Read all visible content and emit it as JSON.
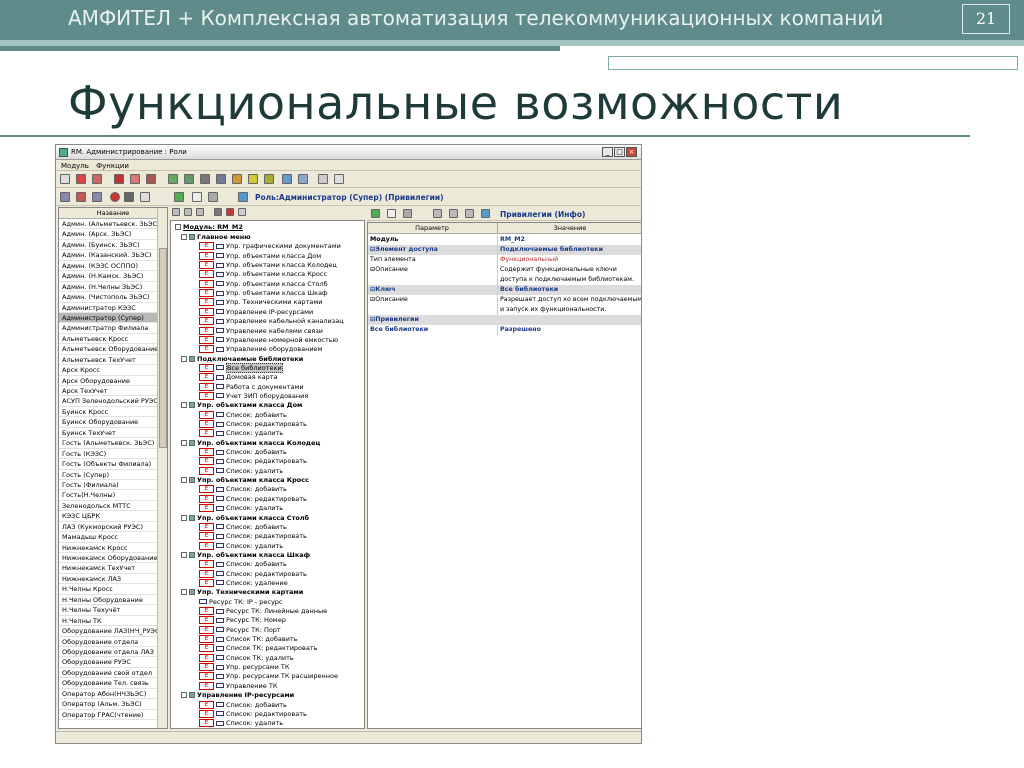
{
  "slide": {
    "header": "АМФИТЕЛ + Комплексная автоматизация телекоммуникационных компаний",
    "number": "21",
    "title": "Функциональные возможности"
  },
  "window": {
    "title": "RM. Администрирование : Роли",
    "menu": [
      "Модуль",
      "Функции"
    ],
    "role_title": "Роль:Администратор (Супер) (Привилегии)",
    "info_title": "Привилегии (Инфо)"
  },
  "roles": {
    "header": "Название",
    "items": [
      "Админ. (Альметьевск. ЗЬЭС)",
      "Админ. (Арск. ЗЬЭС)",
      "Админ. (Буинск. ЗЬЭС)",
      "Админ. (Казанский. ЗЬЭС)",
      "Админ. (КЭЗС ОСППО)",
      "Админ. (Н.Камск. ЗЬЭС)",
      "Админ. (Н.Челны ЗЬЭС)",
      "Админ. (Чистополь ЗЬЭС)",
      "Администратор КЭЗС",
      "Администратор (Супер)",
      "Администратор Филиала",
      "Альметьевск Кросс",
      "Альметьевск Оборудование",
      "Альметьевск ТехУчет",
      "Арск Кросс",
      "Арск Оборудование",
      "Арск ТехУчет",
      "АСУП Зеленодольский РУЭС",
      "Буинск Кросс",
      "Буинск Оборудование",
      "Буинск ТехУчет",
      "Гость (Альметьевск. ЗЬЭС)",
      "Гость (КЭЗС)",
      "Гость (Объекты Филиала)",
      "Гость (Супер)",
      "Гость (Филиала)",
      "Гость(Н.Челны)",
      "Зеленодольск МТТС",
      "КЭЗС ЦБРК",
      "ЛАЗ (Кукморский РУЭС)",
      "Мамадыш Кросс",
      "Нижнекамск Кросс",
      "Нижнекамск Оборудование",
      "Нижнекамск ТехУчет",
      "Нижнекамск ЛАЗ",
      "Н.Челны Кросс",
      "Н.Челны Оборудование",
      "Н.Челны Техучёт",
      "Н.Челны ТК",
      "Оборудование ЛАЗ(НЧ_РУЭС)",
      "Оборудование отдела",
      "Оборудование отдела ЛАЗ",
      "Оборудование РУЭС",
      "Оборудование свой отдел",
      "Оборудование Тел. связь",
      "Оператор Абон(НЧЗЬЭС)",
      "Оператор (Альм. ЗЬЭС)",
      "Оператор ГРАС(чтение)"
    ],
    "selected_index": 9
  },
  "tree": {
    "module_label": "Модуль: RM_M2",
    "nodes": [
      {
        "t": "grp",
        "label": "Главное меню"
      },
      {
        "t": "item",
        "label": "Упр. графическими документами"
      },
      {
        "t": "item",
        "label": "Упр. объектами класса Дом"
      },
      {
        "t": "item",
        "label": "Упр. объектами класса Колодец"
      },
      {
        "t": "item",
        "label": "Упр. объектами класса Кросс"
      },
      {
        "t": "item",
        "label": "Упр. объектами класса Столб"
      },
      {
        "t": "item",
        "label": "Упр. объектами класса Шкаф"
      },
      {
        "t": "item",
        "label": "Упр. Техническими картами"
      },
      {
        "t": "item",
        "label": "Управление IP-ресурсами"
      },
      {
        "t": "item",
        "label": "Управление кабельной канализац"
      },
      {
        "t": "item",
        "label": "Управление кабелями связи"
      },
      {
        "t": "item",
        "label": "Управление номерной емкостью"
      },
      {
        "t": "item",
        "label": "Управление оборудованием"
      },
      {
        "t": "grp",
        "label": "Подключаемые библиотеки"
      },
      {
        "t": "item",
        "label": "Все библиотеки",
        "sel": true
      },
      {
        "t": "item",
        "label": "Домовая карта"
      },
      {
        "t": "item",
        "label": "Работа с документами"
      },
      {
        "t": "item",
        "label": "Учет ЗИП оборудования"
      },
      {
        "t": "grp",
        "label": "Упр. объектами класса Дом"
      },
      {
        "t": "item",
        "label": "Список: добавить"
      },
      {
        "t": "item",
        "label": "Список: редактировать"
      },
      {
        "t": "item",
        "label": "Список: удалить"
      },
      {
        "t": "grp",
        "label": "Упр. объектами класса Колодец"
      },
      {
        "t": "item",
        "label": "Список: добавить"
      },
      {
        "t": "item",
        "label": "Список: редактировать"
      },
      {
        "t": "item",
        "label": "Список: удалить"
      },
      {
        "t": "grp",
        "label": "Упр. объектами класса Кросс"
      },
      {
        "t": "item",
        "label": "Список: добавить"
      },
      {
        "t": "item",
        "label": "Список: редактировать"
      },
      {
        "t": "item",
        "label": "Список: удалить"
      },
      {
        "t": "grp",
        "label": "Упр. объектами класса Столб"
      },
      {
        "t": "item",
        "label": "Список: добавить"
      },
      {
        "t": "item",
        "label": "Список: редактировать"
      },
      {
        "t": "item",
        "label": "Список: удалить"
      },
      {
        "t": "grp",
        "label": "Упр. объектами класса Шкаф"
      },
      {
        "t": "item",
        "label": "Список: добавить"
      },
      {
        "t": "item",
        "label": "Список: редактировать"
      },
      {
        "t": "item",
        "label": "Список: удаление"
      },
      {
        "t": "grp",
        "label": "Упр. Техническими картами"
      },
      {
        "t": "plain",
        "label": "Ресурс ТК: IP - ресурс"
      },
      {
        "t": "item",
        "label": "Ресурс ТК: Линейные данные"
      },
      {
        "t": "item",
        "label": "Ресурс ТК: Номер"
      },
      {
        "t": "item",
        "label": "Ресурс ТК: Порт"
      },
      {
        "t": "item",
        "label": "Список ТК: добавить"
      },
      {
        "t": "item",
        "label": "Список ТК: редактировать"
      },
      {
        "t": "item",
        "label": "Список ТК: удалить"
      },
      {
        "t": "item",
        "label": "Упр. ресурсами ТК"
      },
      {
        "t": "item",
        "label": "Упр. ресурсами ТК расширенное"
      },
      {
        "t": "item",
        "label": "Управление ТК"
      },
      {
        "t": "grp",
        "label": "Управление IP-ресурсами"
      },
      {
        "t": "item",
        "label": "Список: добавить"
      },
      {
        "t": "item",
        "label": "Список: редактировать"
      },
      {
        "t": "item",
        "label": "Список: удалить"
      }
    ]
  },
  "props": {
    "headers": [
      "Параметр",
      "Значение"
    ],
    "rows": [
      {
        "k": "Модуль",
        "v": "RM_M2",
        "kb": true,
        "vc": "blue"
      },
      {
        "k": "⊟Элемент доступа",
        "v": "Подключаемые библиотеки",
        "sec": true,
        "kc": "blue",
        "vc": "blue"
      },
      {
        "k": "  Тип элемента",
        "v": "Функциональный",
        "vc": "red"
      },
      {
        "k": "⊟Описание",
        "v": "Содержит функциональные ключи"
      },
      {
        "k": "",
        "v": "доступа к подключаемым библиотекам."
      },
      {
        "k": "⊟Ключ",
        "v": "Все библиотеки",
        "sec": true,
        "kc": "blue",
        "vc": "blue"
      },
      {
        "k": "⊟Описание",
        "v": "Разрешает доступ ко всем подключаемым би..."
      },
      {
        "k": "",
        "v": "и запуск их функциональности."
      },
      {
        "k": "⊟Привилегии",
        "v": "",
        "sec": true,
        "kc": "blue"
      },
      {
        "k": "  Все библиотеки",
        "v": "Разрешено",
        "kc": "blue",
        "vc": "blue"
      }
    ]
  }
}
